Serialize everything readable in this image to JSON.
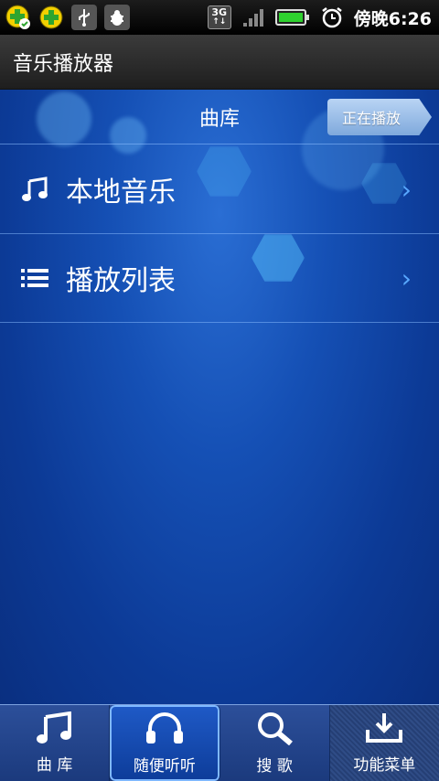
{
  "status_bar": {
    "time": "傍晚6:26",
    "network": "3G",
    "icons": [
      "app-plus-check-icon",
      "app-plus-icon",
      "usb-icon",
      "debug-bug-icon",
      "3g-icon",
      "signal-icon",
      "battery-icon",
      "alarm-clock-icon"
    ]
  },
  "app": {
    "title": "音乐播放器"
  },
  "library": {
    "title": "曲库",
    "now_playing_label": "正在播放",
    "rows": [
      {
        "label": "本地音乐",
        "icon": "music-note-icon"
      },
      {
        "label": "播放列表",
        "icon": "list-icon"
      }
    ]
  },
  "tabs": [
    {
      "label": "曲 库",
      "icon": "music-note-icon",
      "active": false
    },
    {
      "label": "随便听听",
      "icon": "headphones-icon",
      "active": true
    },
    {
      "label": "搜 歌",
      "icon": "search-icon",
      "active": false
    },
    {
      "label": "功能菜单",
      "icon": "download-tray-icon",
      "active": false
    }
  ],
  "colors": {
    "accent": "#58a8ff",
    "background": "#1550b5"
  }
}
